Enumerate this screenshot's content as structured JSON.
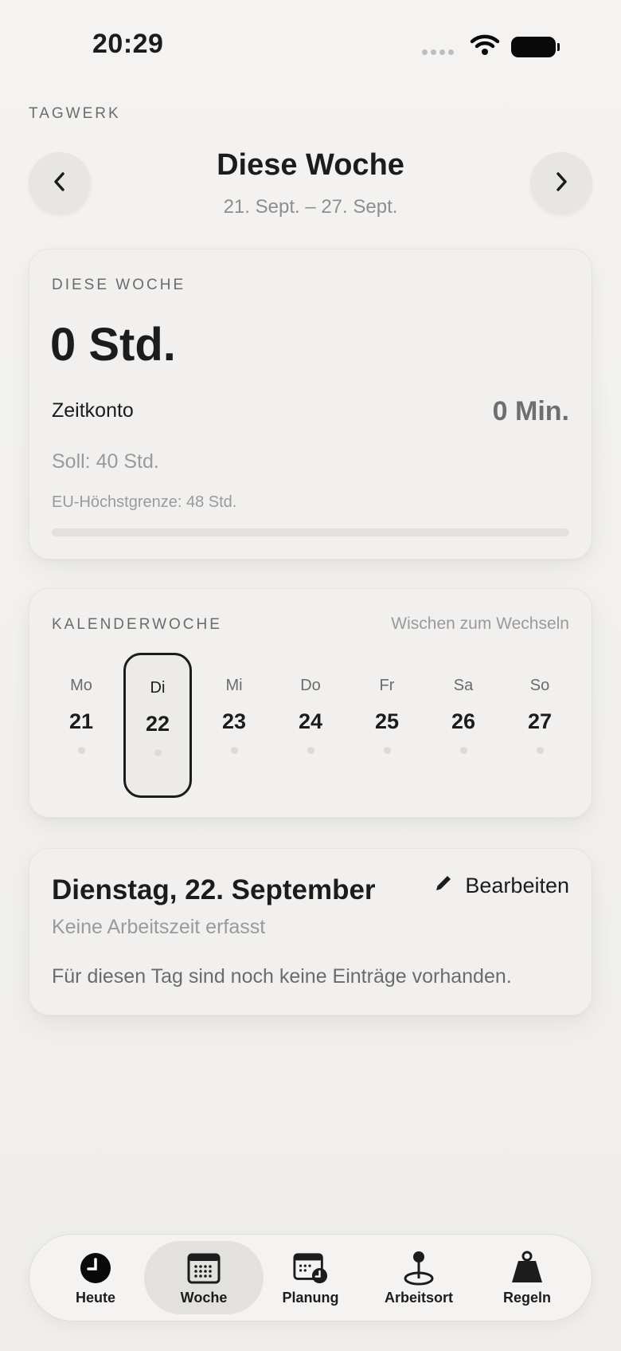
{
  "status_bar": {
    "time": "20:29",
    "icons": [
      "signal-icon",
      "wifi-icon",
      "battery-icon"
    ]
  },
  "app_name": "TAGWERK",
  "week_header": {
    "title": "Diese Woche",
    "range": "21. Sept. – 27. Sept."
  },
  "summary": {
    "label": "DIESE WOCHE",
    "hours": "0 Std.",
    "account_label": "Zeitkonto",
    "account_value": "0 Min.",
    "target": "Soll: 40 Std.",
    "limit": "EU-Höchstgrenze: 48 Std.",
    "progress": 0
  },
  "calendar": {
    "label": "KALENDERWOCHE",
    "hint": "Wischen zum Wechseln",
    "days": [
      {
        "name": "Mo",
        "num": "21"
      },
      {
        "name": "Di",
        "num": "22"
      },
      {
        "name": "Mi",
        "num": "23"
      },
      {
        "name": "Do",
        "num": "24"
      },
      {
        "name": "Fr",
        "num": "25"
      },
      {
        "name": "Sa",
        "num": "26"
      },
      {
        "name": "So",
        "num": "27"
      }
    ],
    "selected": "Di"
  },
  "day_detail": {
    "title": "Dienstag, 22. September",
    "edit_label": "Bearbeiten",
    "subtitle": "Keine Arbeitszeit erfasst",
    "empty_text": "Für diesen Tag sind noch keine Einträge vorhanden."
  },
  "tabs": [
    {
      "label": "Heute",
      "icon": "clock-icon"
    },
    {
      "label": "Woche",
      "icon": "calendar-icon"
    },
    {
      "label": "Planung",
      "icon": "calendar-clock-icon"
    },
    {
      "label": "Arbeitsort",
      "icon": "location-pin-icon"
    },
    {
      "label": "Regeln",
      "icon": "weight-icon"
    }
  ],
  "active_tab": "Woche"
}
